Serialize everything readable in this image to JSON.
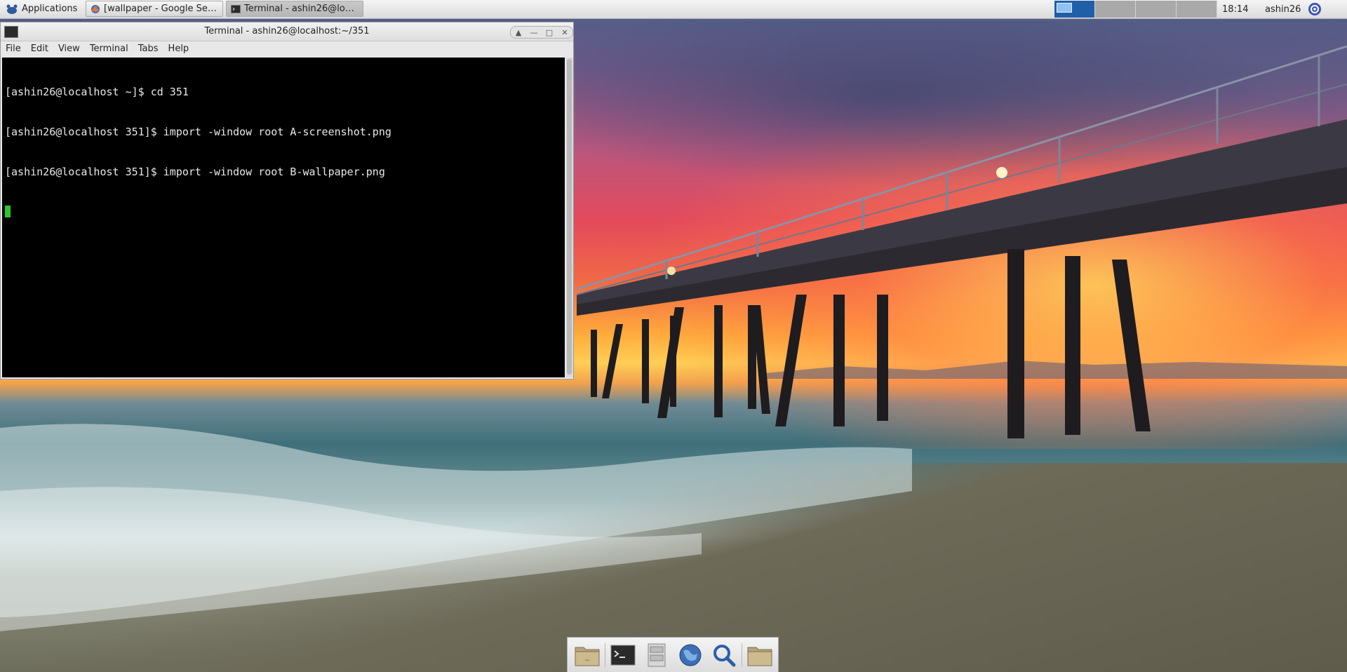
{
  "top_panel": {
    "applications_label": "Applications",
    "tasks": [
      {
        "label": "[wallpaper - Google Sear...",
        "icon": "firefox-icon",
        "active": false
      },
      {
        "label": "Terminal - ashin26@loca...",
        "icon": "terminal-icon",
        "active": true
      }
    ],
    "workspaces": {
      "count": 4,
      "current": 1
    },
    "clock": "18:14",
    "user": "ashin26",
    "colors": {
      "panel": "#dcdcdc",
      "workspace_active": "#1f5fa8"
    }
  },
  "terminal_window": {
    "title": "Terminal - ashin26@localhost:~/351",
    "menu": [
      "File",
      "Edit",
      "View",
      "Terminal",
      "Tabs",
      "Help"
    ],
    "lines": [
      "[ashin26@localhost ~]$ cd 351",
      "[ashin26@localhost 351]$ import -window root A-screenshot.png",
      "[ashin26@localhost 351]$ import -window root B-wallpaper.png"
    ],
    "colors": {
      "background": "#000000",
      "text": "#e8e8e8",
      "cursor": "#2ec52e"
    }
  },
  "dock": {
    "items": [
      "home-folder-icon",
      "terminal-icon",
      "file-cabinet-icon",
      "web-browser-icon",
      "search-icon",
      "folder-icon"
    ]
  },
  "wallpaper": {
    "subject": "pier-at-sunset"
  }
}
